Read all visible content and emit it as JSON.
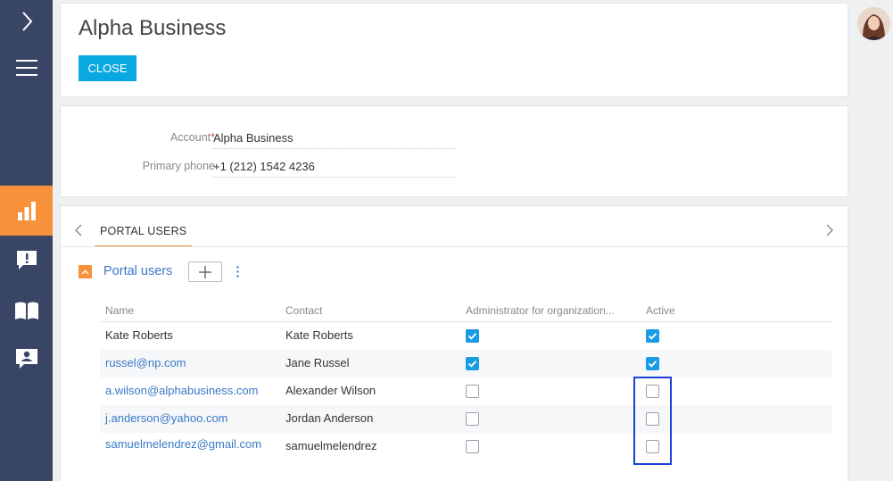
{
  "header": {
    "title": "Alpha Business",
    "close_label": "CLOSE"
  },
  "fields": [
    {
      "label": "Account",
      "required": "*",
      "value": "Alpha Business"
    },
    {
      "label": "Primary phone",
      "value": "+1 (212) 1542 4236"
    }
  ],
  "tabs": [
    {
      "label": "PORTAL USERS",
      "active": true
    }
  ],
  "portal_users": {
    "group_title": "Portal users",
    "columns": [
      "Name",
      "Contact",
      "Administrator for organization...",
      "Active"
    ],
    "rows": [
      {
        "name": "Kate Roberts",
        "name_is_link": false,
        "contact": "Kate Roberts",
        "admin": true,
        "active": true
      },
      {
        "name": "russel@np.com",
        "name_is_link": true,
        "contact": "Jane Russel",
        "admin": true,
        "active": true
      },
      {
        "name": "a.wilson@alphabusiness.com",
        "name_is_link": true,
        "contact": "Alexander Wilson",
        "admin": false,
        "active": false
      },
      {
        "name": "j.anderson@yahoo.com",
        "name_is_link": true,
        "contact": "Jordan Anderson",
        "admin": false,
        "active": false
      },
      {
        "name": "samuelmelendrez@gmail.com",
        "name_is_link": true,
        "contact": "samuelmelendrez",
        "admin": false,
        "active": false
      }
    ]
  },
  "nav_icons": [
    "chevron-right-icon",
    "menu-icon",
    "analytics-icon",
    "cases-icon",
    "knowledge-base-icon",
    "contacts-icon"
  ],
  "colors": {
    "nav_bg": "#394565",
    "accent_orange": "#f7913a",
    "primary_blue": "#0aa8e0",
    "link_blue": "#3a78c6",
    "checkbox_blue": "#1a9ce5",
    "highlight_blue": "#1d3fd8"
  }
}
